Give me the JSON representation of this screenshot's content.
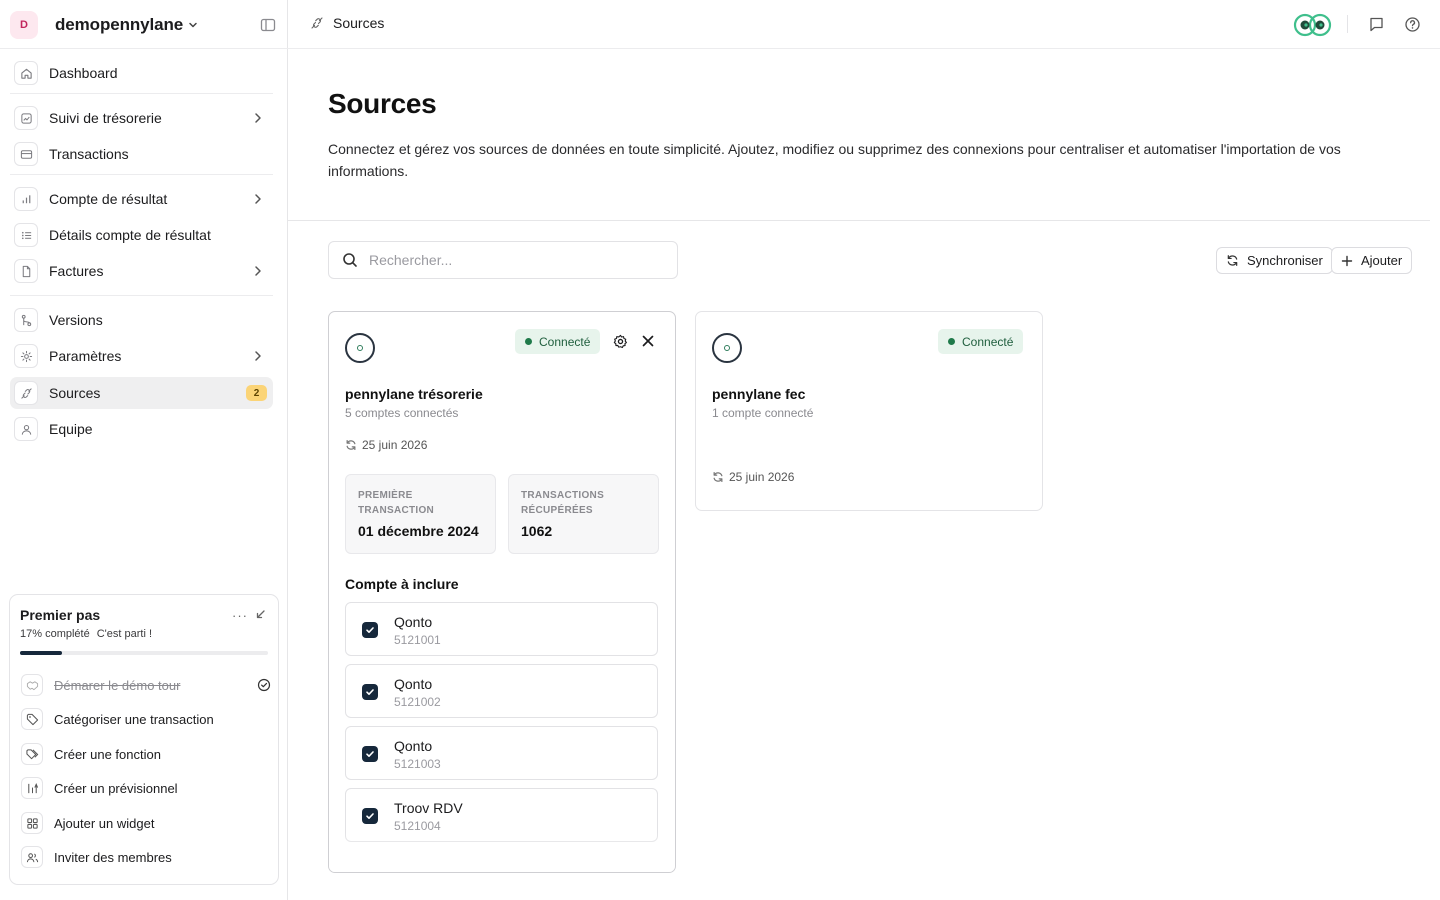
{
  "workspace": {
    "avatar_letter": "D",
    "name": "demopennylane"
  },
  "sidebar": {
    "items": [
      {
        "label": "Dashboard",
        "icon": "home-icon"
      },
      {
        "label": "Suivi de trésorerie",
        "icon": "trend-chart-icon",
        "chevron": true
      },
      {
        "label": "Transactions",
        "icon": "card-icon"
      },
      {
        "label": "Compte de résultat",
        "icon": "bar-chart-icon",
        "chevron": true
      },
      {
        "label": "Détails compte de résultat",
        "icon": "list-icon"
      },
      {
        "label": "Factures",
        "icon": "file-icon",
        "chevron": true
      },
      {
        "label": "Versions",
        "icon": "git-branch-icon"
      },
      {
        "label": "Paramètres",
        "icon": "gear-icon",
        "chevron": true
      },
      {
        "label": "Sources",
        "icon": "plug-icon",
        "badge": "2",
        "active": true
      },
      {
        "label": "Equipe",
        "icon": "user-icon"
      }
    ]
  },
  "onboarding": {
    "title": "Premier pas",
    "more": "···",
    "progress_text": "17% complété",
    "progress_sub": "C'est parti !",
    "progress": 0.17,
    "steps": [
      {
        "label": "Démarer le démo tour",
        "icon": "handshake-icon",
        "done": true
      },
      {
        "label": "Catégoriser une transaction",
        "icon": "tag-icon"
      },
      {
        "label": "Créer une fonction",
        "icon": "tags-icon"
      },
      {
        "label": "Créer un prévisionnel",
        "icon": "forecast-icon"
      },
      {
        "label": "Ajouter un widget",
        "icon": "grid-icon"
      },
      {
        "label": "Inviter des membres",
        "icon": "users-icon"
      }
    ]
  },
  "topbar": {
    "breadcrumb": "Sources"
  },
  "main": {
    "title": "Sources",
    "description": "Connectez et gérez vos sources de données en toute simplicité. Ajoutez, modifiez ou supprimez des connexions pour centraliser et automatiser l'importation de vos informations.",
    "search_placeholder": "Rechercher...",
    "sync_label": "Synchroniser",
    "add_label": "Ajouter"
  },
  "sources": [
    {
      "name": "pennylane trésorerie",
      "status": "Connecté",
      "accounts_count": "5 comptes connectés",
      "last_sync": "25 juin 2026",
      "stats": [
        {
          "label": "Première transaction",
          "value": "01 décembre 2024"
        },
        {
          "label": "Transactions récupérées",
          "value": "1062"
        }
      ],
      "accounts_title": "Compte à inclure",
      "accounts": [
        {
          "name": "Qonto",
          "number": "5121001",
          "checked": true
        },
        {
          "name": "Qonto",
          "number": "5121002",
          "checked": true
        },
        {
          "name": "Qonto",
          "number": "5121003",
          "checked": true
        },
        {
          "name": "Troov RDV",
          "number": "5121004",
          "checked": true
        }
      ]
    },
    {
      "name": "pennylane fec",
      "status": "Connecté",
      "accounts_count": "1 compte connecté",
      "last_sync": "25 juin 2026"
    }
  ],
  "colors": {
    "accent": "#16283b",
    "status_bg": "#e7f4ec",
    "status_text": "#1f5e3d",
    "badge": "#fbd477",
    "logo_ring": "#3fbf8c"
  }
}
